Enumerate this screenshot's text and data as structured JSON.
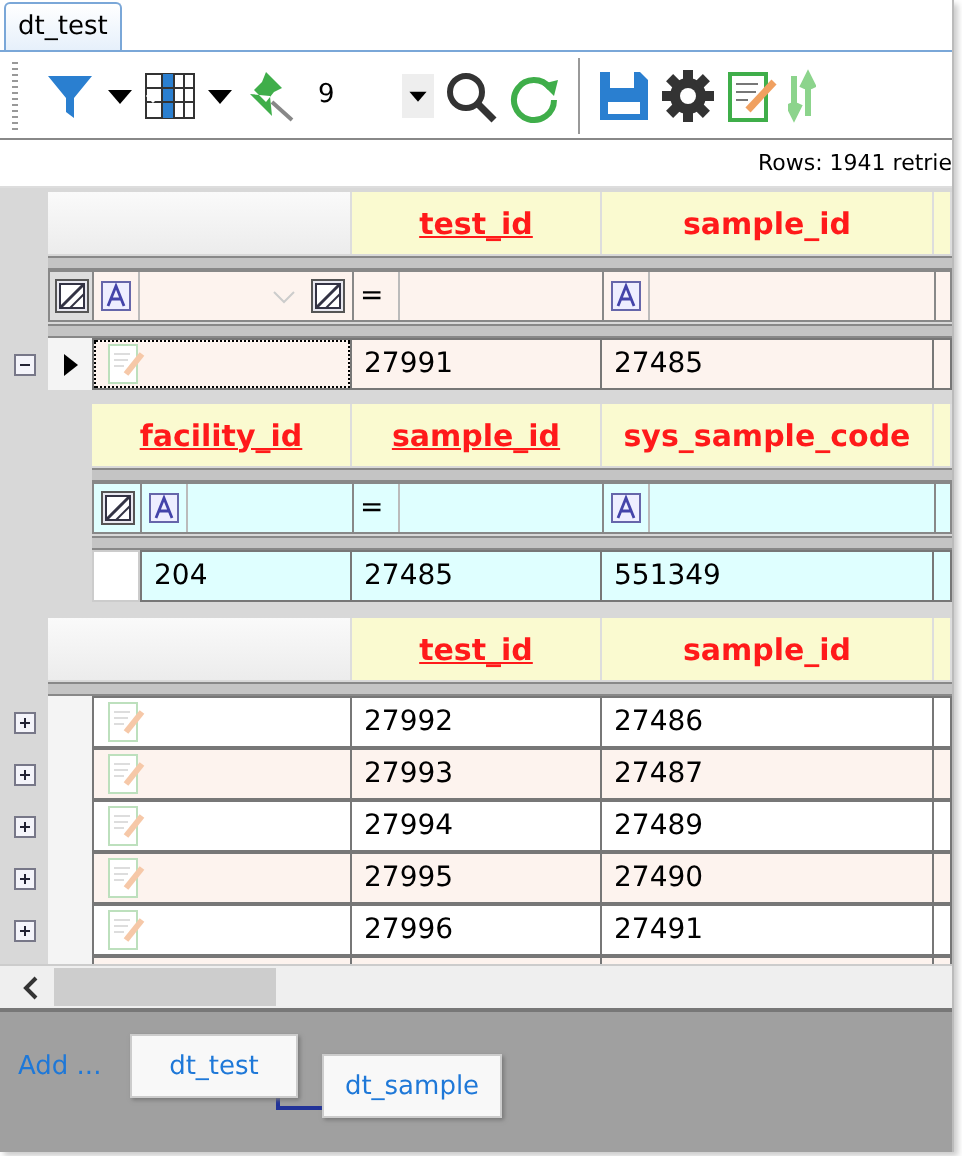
{
  "tab": {
    "label": "dt_test",
    "selected": true
  },
  "toolbar": {
    "page_size": "9"
  },
  "status": "Rows: 1941 retrie",
  "master": {
    "columns": [
      {
        "label": "test_id",
        "underlined": true
      },
      {
        "label": "sample_id",
        "underlined": false
      }
    ],
    "filters": [
      {
        "kind": "equals",
        "operator": "="
      },
      {
        "kind": "text"
      }
    ],
    "row": {
      "values": [
        "27991",
        "27485"
      ],
      "expanded": true,
      "current": true
    }
  },
  "detail": {
    "columns": [
      {
        "label": "facility_id",
        "underlined": true
      },
      {
        "label": "sample_id",
        "underlined": true
      },
      {
        "label": "sys_sample_code",
        "underlined": false
      }
    ],
    "filters": [
      {
        "kind": "text"
      },
      {
        "kind": "equals",
        "operator": "="
      },
      {
        "kind": "text"
      }
    ],
    "rows": [
      {
        "values": [
          "204",
          "27485",
          "551349"
        ]
      }
    ]
  },
  "list": {
    "columns": [
      {
        "label": "test_id",
        "underlined": true
      },
      {
        "label": "sample_id",
        "underlined": false
      }
    ],
    "rows": [
      {
        "values": [
          "27992",
          "27486"
        ],
        "expanded": false,
        "current": false
      },
      {
        "values": [
          "27993",
          "27487"
        ],
        "expanded": false,
        "current": false
      },
      {
        "values": [
          "27994",
          "27489"
        ],
        "expanded": false,
        "current": false
      },
      {
        "values": [
          "27995",
          "27490"
        ],
        "expanded": false,
        "current": false
      },
      {
        "values": [
          "27996",
          "27491"
        ],
        "expanded": false,
        "current": false
      }
    ]
  },
  "designer": {
    "add_link": "Add ...",
    "tables": [
      {
        "name": "dt_test"
      },
      {
        "name": "dt_sample"
      }
    ]
  }
}
